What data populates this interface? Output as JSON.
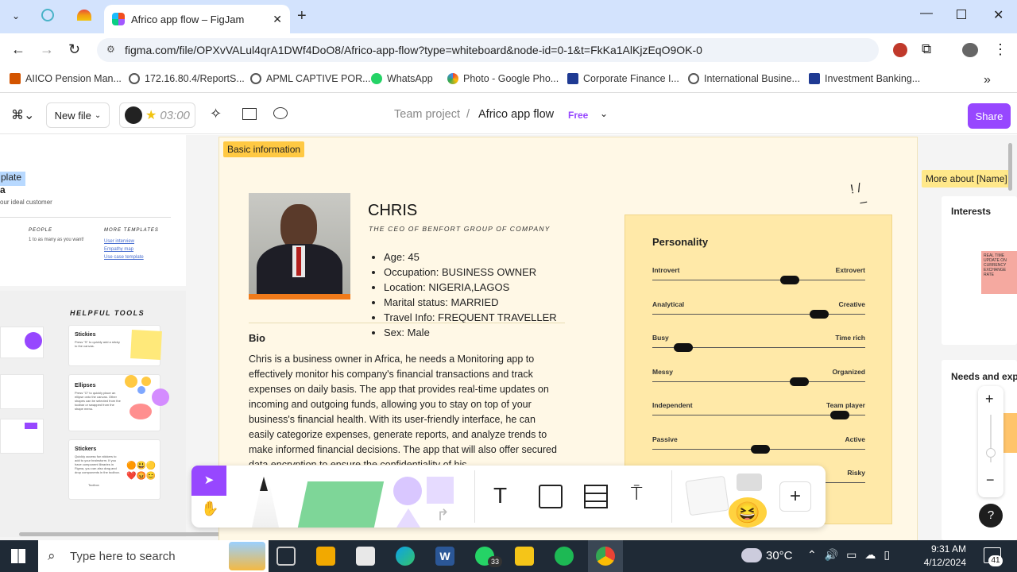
{
  "browser": {
    "tab_title": "Africo app flow – FigJam",
    "url": "figma.com/file/OPXvVALul4qrA1DWf4DoO8/Africo-app-flow?type=whiteboard&node-id=0-1&t=FkKa1AlKjzEqO9OK-0",
    "bookmarks": [
      "AIICO Pension Man...",
      "172.16.80.4/ReportS...",
      "APML CAPTIVE POR...",
      "WhatsApp",
      "Photo - Google Pho...",
      "Corporate Finance I...",
      "International Busine...",
      "Investment Banking..."
    ]
  },
  "figjam": {
    "new_file": "New file",
    "timer": "03:00",
    "breadcrumb_team": "Team project",
    "breadcrumb_sep": "/",
    "file_name": "Africo app flow",
    "plan_badge": "Free",
    "share": "Share"
  },
  "left_panel": {
    "template_tag": "plate",
    "template_title": "a",
    "template_desc": "our ideal customer",
    "people_heading": "PEOPLE",
    "people_text": "1 to as many as you want!",
    "more_heading": "MORE TEMPLATES",
    "more_links": [
      "User interview",
      "Empathy map",
      "Use case template"
    ],
    "helpful_tools": "HELPFUL TOOLS",
    "tools": [
      {
        "title": "Stickies",
        "desc": "Press \"S\" to quickly add a sticky to the canvas."
      },
      {
        "title": "Ellipses",
        "desc": "Press \"O\" to quickly place an ellipse onto the canvas. Other shapes can be selected from the toolbar or swapped from the shape menu."
      },
      {
        "title": "Stickers",
        "desc": "Quickly access fun stickers to add to your brainstorm. If you have component libraries in Figma, you can also drag and drop components in the toolbox.",
        "extra": "Toolbox"
      }
    ]
  },
  "persona": {
    "section_label": "Basic information",
    "name": "CHRIS",
    "role": "THE CEO  OF BENFORT GROUP OF COMPANY",
    "facts": [
      "Age: 45",
      "Occupation: BUSINESS OWNER",
      "Location: NIGERIA,LAGOS",
      "Marital status: MARRIED",
      "Travel Info: FREQUENT TRAVELLER",
      "Sex: Male"
    ],
    "bio_heading": "Bio",
    "bio_text": "Chris is a business owner in Africa, he needs a Monitoring app to effectively monitor his company's financial transactions and track expenses on daily basis. The app that provides real-time updates on incoming and outgoing funds, allowing you to stay on top of your business's financial health. With its user-friendly interface, he can easily categorize expenses, generate reports, and analyze trends to make informed financial decisions. The app that will also offer secured data encryption to ensure the confidentiality of his"
  },
  "personality": {
    "title": "Personality",
    "sliders": [
      {
        "left": "Introvert",
        "right": "Extrovert",
        "value": 0.66
      },
      {
        "left": "Analytical",
        "right": "Creative",
        "value": 0.81
      },
      {
        "left": "Busy",
        "right": "Time rich",
        "value": 0.11
      },
      {
        "left": "Messy",
        "right": "Organized",
        "value": 0.71
      },
      {
        "left": "Independent",
        "right": "Team player",
        "value": 0.92
      },
      {
        "left": "Passive",
        "right": "Active",
        "value": 0.51
      },
      {
        "left": "",
        "right": "Risky",
        "value": null
      }
    ]
  },
  "right_panel": {
    "more_about": "More about [Name]",
    "interests": "Interests",
    "sticky_text": "REAL TIME UPDATE ON CURRENCY EXCHANGE RATE",
    "needs": "Needs and exp"
  },
  "taskbar": {
    "search_placeholder": "Type here to search",
    "whatsapp_badge": "33",
    "weather": "30°C",
    "time": "9:31 AM",
    "date": "4/12/2024",
    "notif_count": "41"
  },
  "colors": {
    "figjam_purple": "#9747ff",
    "section_yellow": "#ffe88a",
    "card_bg": "#fff8e6",
    "personality_bg": "#ffe9a8"
  }
}
